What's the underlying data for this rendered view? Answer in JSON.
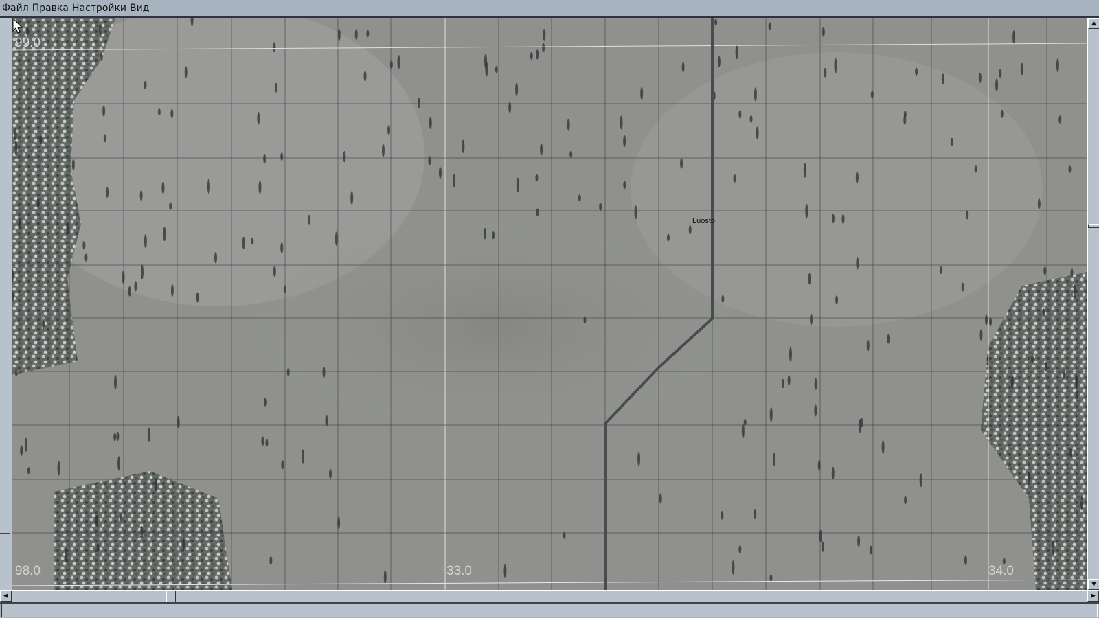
{
  "menu": {
    "items": [
      {
        "label": "Файл"
      },
      {
        "label": "Правка"
      },
      {
        "label": "Настройки"
      },
      {
        "label": "Вид"
      }
    ]
  },
  "map": {
    "town_label": "Luosto",
    "grid_labels": {
      "top_left": "99.0",
      "bottom_left": "98.0",
      "bottom_mid": "33.0",
      "bottom_right": "34.0"
    },
    "colors": {
      "terrain": "#8e8f8c",
      "road": "#4a4b4e",
      "grid": "#3d3f40",
      "major_grid": "#e8e8e8"
    }
  },
  "scrollbars": {
    "up_icon": "triangle-up",
    "down_icon": "triangle-down",
    "left_icon": "triangle-left",
    "right_icon": "triangle-right",
    "up": "▲",
    "down": "▼",
    "left": "◀",
    "right": "▶"
  }
}
